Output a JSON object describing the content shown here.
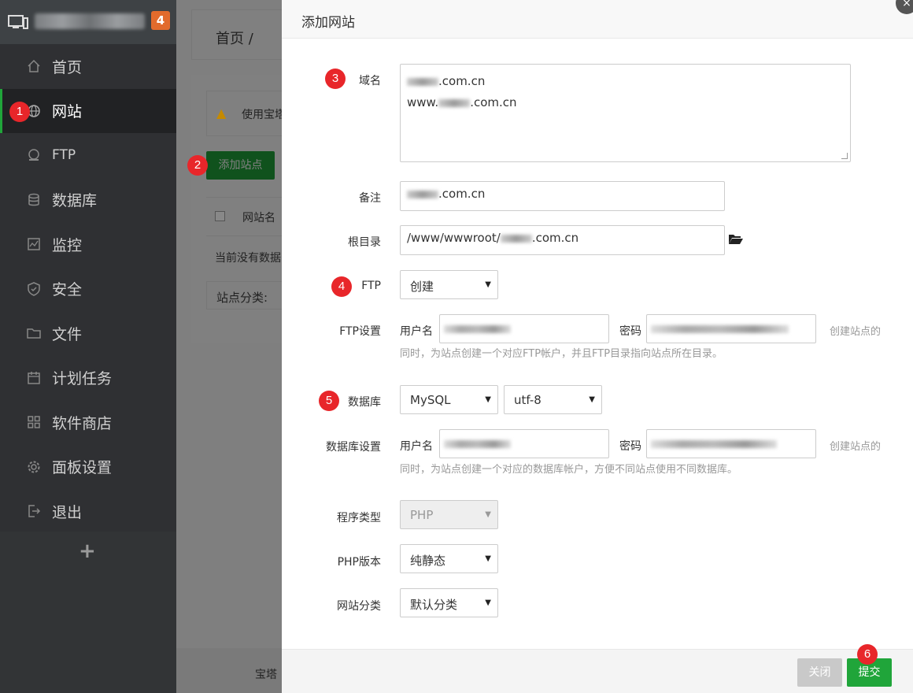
{
  "sidebar": {
    "badge": "4",
    "items": [
      {
        "label": "首页",
        "icon": "home-icon"
      },
      {
        "label": "网站",
        "icon": "globe-icon"
      },
      {
        "label": "FTP",
        "icon": "ftp-icon"
      },
      {
        "label": "数据库",
        "icon": "database-icon"
      },
      {
        "label": "监控",
        "icon": "monitor-icon"
      },
      {
        "label": "安全",
        "icon": "shield-icon"
      },
      {
        "label": "文件",
        "icon": "folder-icon"
      },
      {
        "label": "计划任务",
        "icon": "calendar-icon"
      },
      {
        "label": "软件商店",
        "icon": "apps-icon"
      },
      {
        "label": "面板设置",
        "icon": "gear-icon"
      },
      {
        "label": "退出",
        "icon": "logout-icon"
      }
    ],
    "add": "+"
  },
  "main": {
    "breadcrumb": "首页 /",
    "warning": "使用宝塔",
    "add_site": "添加站点",
    "col_site_name": "网站名",
    "empty": "当前没有数据",
    "category": "站点分类:",
    "footer": "宝塔"
  },
  "markers": [
    "1",
    "2",
    "3",
    "4",
    "5",
    "6"
  ],
  "modal": {
    "title": "添加网站",
    "close_icon": "×",
    "domain": {
      "label": "域名",
      "line1_suffix": ".com.cn",
      "line2_prefix": "www.",
      "line2_suffix": ".com.cn"
    },
    "note": {
      "label": "备注",
      "suffix": ".com.cn"
    },
    "root": {
      "label": "根目录",
      "prefix": "/www/wwwroot/",
      "suffix": ".com.cn"
    },
    "ftp": {
      "label": "FTP",
      "value": "创建"
    },
    "ftp_settings": {
      "label": "FTP设置",
      "user": "用户名",
      "pass": "密码",
      "hint_side": "创建站点的",
      "hint": "同时，为站点创建一个对应FTP帐户，并且FTP目录指向站点所在目录。"
    },
    "database": {
      "label": "数据库",
      "value": "MySQL",
      "charset": "utf-8"
    },
    "db_settings": {
      "label": "数据库设置",
      "user": "用户名",
      "pass": "密码",
      "hint_side": "创建站点的",
      "hint": "同时，为站点创建一个对应的数据库帐户，方便不同站点使用不同数据库。"
    },
    "program_type": {
      "label": "程序类型",
      "value": "PHP"
    },
    "php_version": {
      "label": "PHP版本",
      "value": "纯静态"
    },
    "site_category": {
      "label": "网站分类",
      "value": "默认分类"
    },
    "buttons": {
      "close": "关闭",
      "submit": "提交"
    }
  },
  "colors": {
    "accent": "#20a53a",
    "marker": "#e8262a",
    "sidebar": "#2f3033",
    "badge": "#e26b2c"
  }
}
